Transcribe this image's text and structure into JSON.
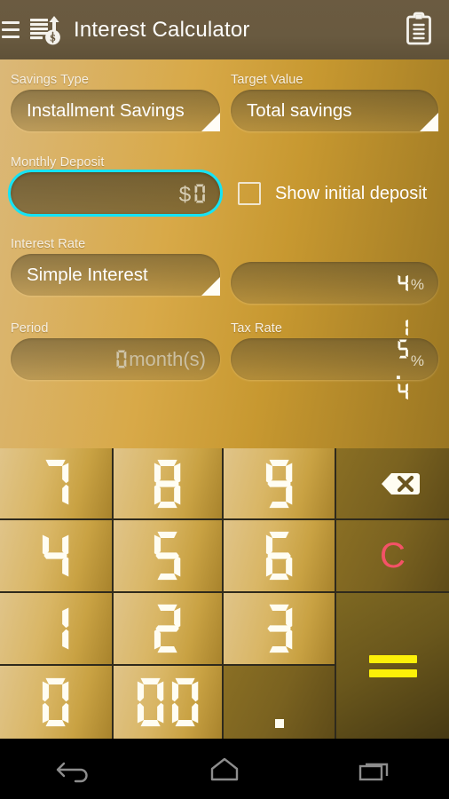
{
  "header": {
    "title": "Interest Calculator",
    "menu_icon": "hamburger-menu-icon",
    "app_icon": "interest-chart-dollar-icon",
    "clipboard_icon": "clipboard-icon"
  },
  "form": {
    "savings_type": {
      "label": "Savings Type",
      "value": "Installment Savings",
      "dropdown_icon": "dropdown-triangle-icon"
    },
    "target_value": {
      "label": "Target Value",
      "value": "Total savings",
      "dropdown_icon": "dropdown-triangle-icon"
    },
    "monthly_deposit": {
      "label": "Monthly Deposit",
      "currency_symbol": "$",
      "value": "0",
      "focused": true
    },
    "show_initial_deposit": {
      "label": "Show initial deposit",
      "checked": false
    },
    "interest_rate": {
      "label": "Interest Rate",
      "type_value": "Simple Interest",
      "dropdown_icon": "dropdown-triangle-icon",
      "rate_value": "4",
      "rate_unit": "%"
    },
    "period": {
      "label": "Period",
      "value": "0",
      "unit": "month(s)"
    },
    "tax_rate": {
      "label": "Tax Rate",
      "value": "15.4",
      "unit": "%"
    }
  },
  "keypad": {
    "rows": [
      [
        {
          "label": "7",
          "kind": "digit"
        },
        {
          "label": "8",
          "kind": "digit"
        },
        {
          "label": "9",
          "kind": "digit"
        },
        {
          "label": "",
          "kind": "backspace",
          "icon": "backspace-icon"
        }
      ],
      [
        {
          "label": "4",
          "kind": "digit"
        },
        {
          "label": "5",
          "kind": "digit"
        },
        {
          "label": "6",
          "kind": "digit"
        },
        {
          "label": "C",
          "kind": "clear"
        }
      ],
      [
        {
          "label": "1",
          "kind": "digit"
        },
        {
          "label": "2",
          "kind": "digit"
        },
        {
          "label": "3",
          "kind": "digit"
        },
        {
          "label": "=",
          "kind": "equals",
          "icon": "equals-icon"
        }
      ],
      [
        {
          "label": "0",
          "kind": "digit"
        },
        {
          "label": "00",
          "kind": "digit"
        },
        {
          "label": ".",
          "kind": "decimal",
          "icon": "decimal-point-icon"
        }
      ]
    ]
  },
  "navbar": {
    "back_icon": "back-arrow-icon",
    "home_icon": "home-icon",
    "recents_icon": "recent-apps-icon"
  },
  "colors": {
    "header_bg": "#695a40",
    "panel_gold_light": "#dbb878",
    "panel_gold_dark": "#9a7622",
    "focus_cyan": "#15e3f5",
    "clear_red": "#f45267",
    "equals_yellow": "#fcf008",
    "lcd_white": "#fffdf2",
    "navbar_bg": "#000000"
  }
}
